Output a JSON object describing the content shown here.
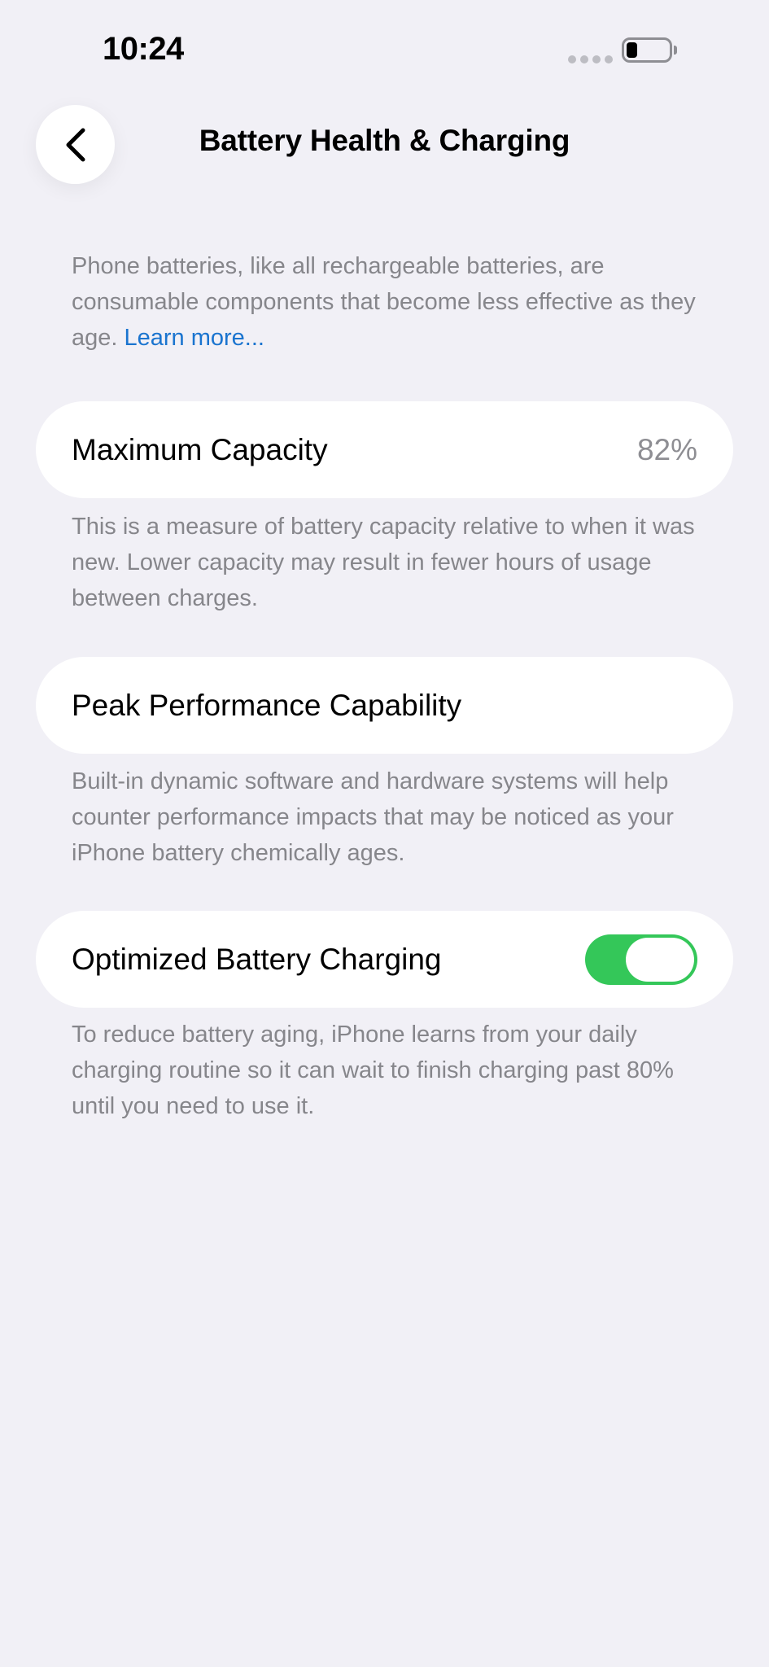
{
  "status_bar": {
    "time": "10:24"
  },
  "nav": {
    "title": "Battery Health & Charging",
    "back_icon": "chevron-left-icon"
  },
  "intro": {
    "text": "Phone batteries, like all rechargeable batteries, are consumable components that become less effective as they age. ",
    "link_label": "Learn more..."
  },
  "max_capacity": {
    "label": "Maximum Capacity",
    "value": "82%",
    "description": "This is a measure of battery capacity relative to when it was new. Lower capacity may result in fewer hours of usage between charges."
  },
  "peak_performance": {
    "label": "Peak Performance Capability",
    "description": "Built-in dynamic software and hardware systems will help counter performance impacts that may be noticed as your iPhone battery chemically ages."
  },
  "optimized_charging": {
    "label": "Optimized Battery Charging",
    "enabled": true,
    "description": "To reduce battery aging, iPhone learns from your daily charging routine so it can wait to finish charging past 80% until you need to use it."
  },
  "colors": {
    "background": "#f1f0f6",
    "link": "#1a74cf",
    "toggle_on": "#34c759",
    "secondary_text": "#86868b"
  }
}
